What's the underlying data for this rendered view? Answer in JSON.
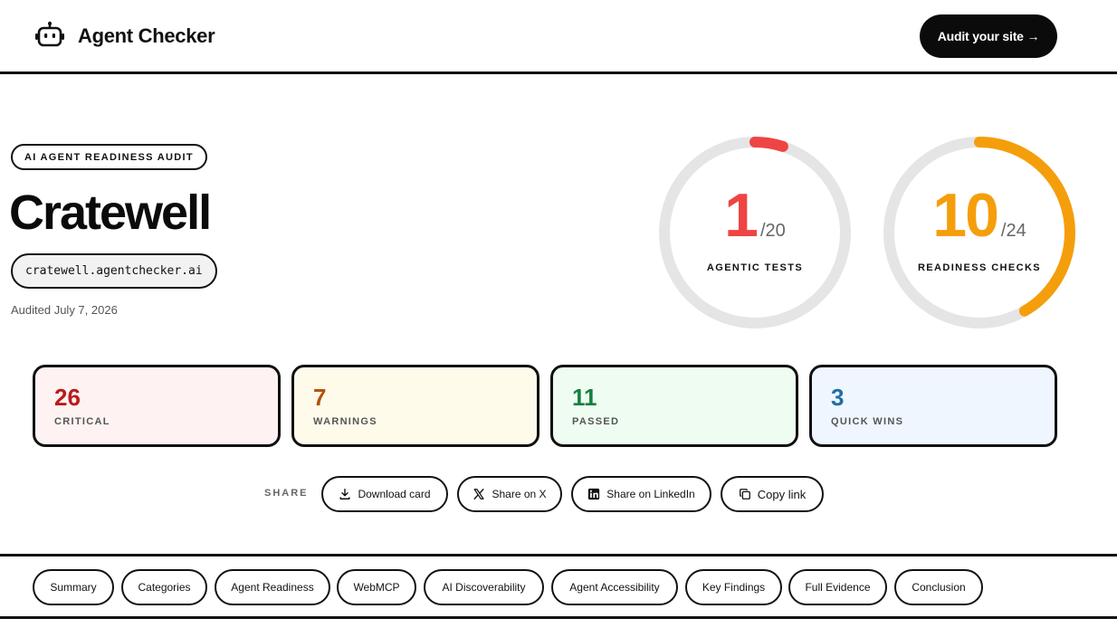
{
  "header": {
    "logo_icon": "robot-icon",
    "brand": "Agent Checker",
    "cta_label": "Audit your site →"
  },
  "hero": {
    "tag": "AI AGENT READINESS AUDIT",
    "site_name": "Cratewell",
    "domain": "cratewell.agentchecker.ai",
    "audited": "Audited July 7, 2026"
  },
  "scores": [
    {
      "value": "1",
      "denominator": "/20",
      "label": "AGENTIC TESTS",
      "fraction": 0.05,
      "color": "#ef4444"
    },
    {
      "value": "10",
      "denominator": "/24",
      "label": "READINESS CHECKS",
      "fraction": 0.4167,
      "color": "#f59e0b"
    }
  ],
  "stats": [
    {
      "value": "26",
      "label": "CRITICAL",
      "color": "#b91c1c",
      "bg": "#fef2f2"
    },
    {
      "value": "7",
      "label": "WARNINGS",
      "color": "#b45309",
      "bg": "#fefbea"
    },
    {
      "value": "11",
      "label": "PASSED",
      "color": "#15803d",
      "bg": "#eefcf1"
    },
    {
      "value": "3",
      "label": "QUICK WINS",
      "color": "#1d6fa5",
      "bg": "#eff6ff"
    }
  ],
  "share": {
    "label": "SHARE",
    "buttons": [
      {
        "label": "Download card",
        "icon": "download-icon"
      },
      {
        "label": "Share on X",
        "icon": "x-logo-icon"
      },
      {
        "label": "Share on LinkedIn",
        "icon": "linkedin-icon"
      },
      {
        "label": "Copy link",
        "icon": "copy-icon"
      }
    ]
  },
  "tabs": [
    "Summary",
    "Categories",
    "Agent Readiness",
    "WebMCP",
    "AI Discoverability",
    "Agent Accessibility",
    "Key Findings",
    "Full Evidence",
    "Conclusion"
  ]
}
